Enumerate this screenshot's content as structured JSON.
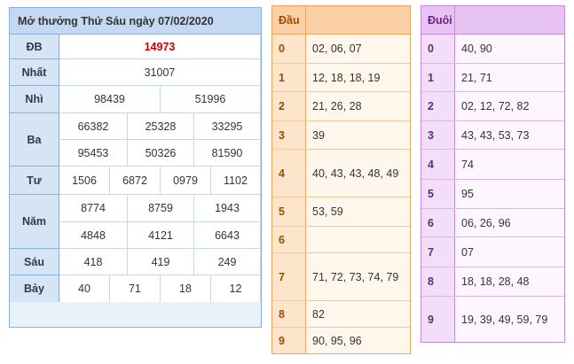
{
  "results": {
    "title": "Mở thưởng Thứ Sáu ngày 07/02/2020",
    "prizes": {
      "db": {
        "label": "ĐB",
        "values": [
          "14973"
        ]
      },
      "nhat": {
        "label": "Nhất",
        "values": [
          "31007"
        ]
      },
      "nhi": {
        "label": "Nhì",
        "values": [
          "98439",
          "51996"
        ]
      },
      "ba": {
        "label": "Ba",
        "values": [
          "66382",
          "25328",
          "33295",
          "95453",
          "50326",
          "81590"
        ]
      },
      "tu": {
        "label": "Tư",
        "values": [
          "1506",
          "6872",
          "0979",
          "1102"
        ]
      },
      "nam": {
        "label": "Năm",
        "values": [
          "8774",
          "8759",
          "1943",
          "4848",
          "4121",
          "6643"
        ]
      },
      "sau": {
        "label": "Sáu",
        "values": [
          "418",
          "419",
          "249"
        ]
      },
      "bay": {
        "label": "Bảy",
        "values": [
          "40",
          "71",
          "18",
          "12"
        ]
      }
    }
  },
  "dau": {
    "header": "Đầu",
    "rows": [
      {
        "key": "0",
        "value": "02, 06, 07"
      },
      {
        "key": "1",
        "value": "12, 18, 18, 19"
      },
      {
        "key": "2",
        "value": "21, 26, 28"
      },
      {
        "key": "3",
        "value": "39"
      },
      {
        "key": "4",
        "value": "40, 43, 43, 48, 49"
      },
      {
        "key": "5",
        "value": "53, 59"
      },
      {
        "key": "6",
        "value": ""
      },
      {
        "key": "7",
        "value": "71, 72, 73, 74, 79"
      },
      {
        "key": "8",
        "value": "82"
      },
      {
        "key": "9",
        "value": "90, 95, 96"
      }
    ]
  },
  "duoi": {
    "header": "Đuôi",
    "rows": [
      {
        "key": "0",
        "value": "40, 90"
      },
      {
        "key": "1",
        "value": "21, 71"
      },
      {
        "key": "2",
        "value": "02, 12, 72, 82"
      },
      {
        "key": "3",
        "value": "43, 43, 53, 73"
      },
      {
        "key": "4",
        "value": "74"
      },
      {
        "key": "5",
        "value": "95"
      },
      {
        "key": "6",
        "value": "06, 26, 96"
      },
      {
        "key": "7",
        "value": "07"
      },
      {
        "key": "8",
        "value": "18, 18, 28, 48"
      },
      {
        "key": "9",
        "value": "19, 39, 49, 59, 79"
      }
    ]
  },
  "colors": {
    "special_prize": "#d10000",
    "results_header": "#c4d9f1",
    "dau_header": "#fbd0a7",
    "duoi_header": "#e7c3f2"
  }
}
